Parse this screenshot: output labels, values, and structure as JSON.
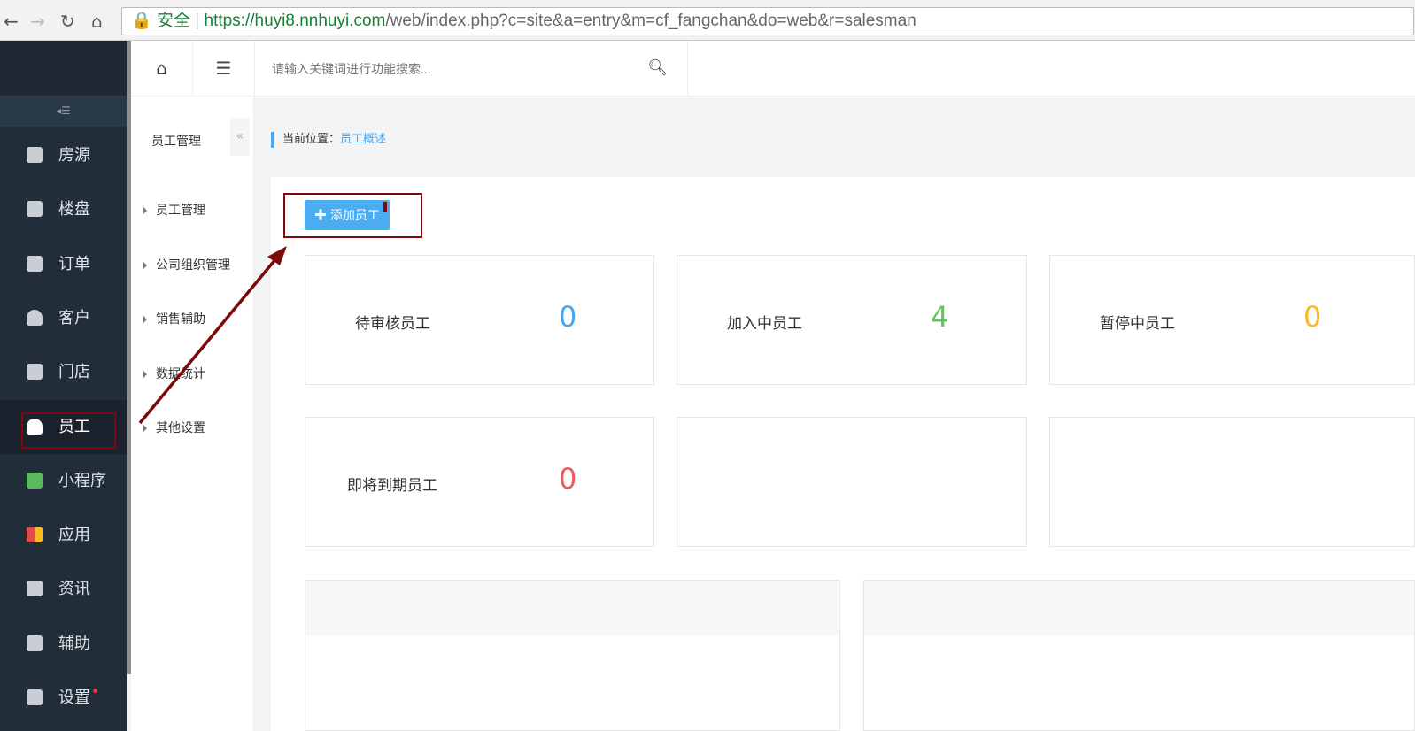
{
  "browser": {
    "secure_label": "安全",
    "url_host": "https://huyi8.nnhuyi.com",
    "url_path": "/web/index.php?c=site&a=entry&m=cf_fangchan&do=web&r=salesman"
  },
  "sidebar": {
    "items": [
      {
        "label": "房源",
        "icon": "house-icon"
      },
      {
        "label": "楼盘",
        "icon": "building-icon"
      },
      {
        "label": "订单",
        "icon": "document-icon"
      },
      {
        "label": "客户",
        "icon": "user-icon"
      },
      {
        "label": "门店",
        "icon": "store-icon"
      },
      {
        "label": "员工",
        "icon": "user-icon",
        "active": true
      },
      {
        "label": "小程序",
        "icon": "miniprogram-icon"
      },
      {
        "label": "应用",
        "icon": "apps-icon"
      },
      {
        "label": "资讯",
        "icon": "tag-icon"
      },
      {
        "label": "辅助",
        "icon": "edit-icon"
      },
      {
        "label": "设置",
        "icon": "gear-icon",
        "badge": true
      }
    ]
  },
  "header": {
    "search_placeholder": "请输入关键词进行功能搜索..."
  },
  "submenu": {
    "title": "员工管理",
    "items": [
      "员工管理",
      "公司组织管理",
      "销售辅助",
      "数据统计",
      "其他设置"
    ]
  },
  "breadcrumb": {
    "label": "当前位置：",
    "current": "员工概述"
  },
  "main": {
    "add_button": "添加员工",
    "stats": [
      {
        "label": "待审核员工",
        "value": "0",
        "color": "#45a8f4"
      },
      {
        "label": "加入中员工",
        "value": "4",
        "color": "#5cc85c"
      },
      {
        "label": "暂停中员工",
        "value": "0",
        "color": "#f7b924"
      },
      {
        "label": "即将到期员工",
        "value": "0",
        "color": "#ee5b5b"
      }
    ]
  },
  "colors": {
    "annotation": "#7d0a0a",
    "accent": "#45a8f4",
    "sidebar_bg": "#222d3a"
  }
}
